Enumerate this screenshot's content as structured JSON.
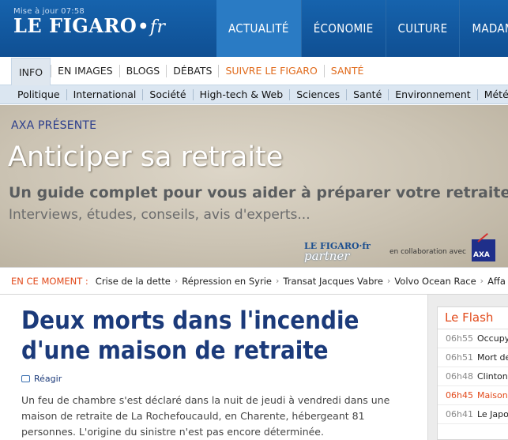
{
  "header": {
    "update_text": "Mise à jour 07:58",
    "logo_main": "LE FIGARO",
    "logo_dot": "•",
    "logo_fr": "fr",
    "tabs": [
      {
        "label": "ACTUALITÉ",
        "active": true
      },
      {
        "label": "ÉCONOMIE",
        "active": false
      },
      {
        "label": "CULTURE",
        "active": false
      },
      {
        "label": "MADAME",
        "active": false
      }
    ]
  },
  "subnav": {
    "items": [
      {
        "label": "INFO",
        "active": true
      },
      {
        "label": "EN IMAGES"
      },
      {
        "label": "BLOGS"
      },
      {
        "label": "DÉBATS"
      },
      {
        "label": "SUIVRE LE FIGARO",
        "orange": true
      },
      {
        "label": "SANTÉ",
        "orange": true
      }
    ]
  },
  "rubnav": {
    "items": [
      "Politique",
      "International",
      "Société",
      "High-tech & Web",
      "Sciences",
      "Santé",
      "Environnement",
      "Météo"
    ]
  },
  "ad": {
    "pre": "AXA PRÉSENTE",
    "headline": "Anticiper sa retraite",
    "sub": "Un guide complet  pour vous aider  à préparer votre retraite",
    "sub2": "Interviews, études,  conseils, avis d'experts...",
    "partner_top": "LE FIGARO·fr",
    "partner_bottom": "partner",
    "collab": "en collaboration avec",
    "axa": "AXA"
  },
  "moment": {
    "label": "EN CE MOMENT :",
    "topics": [
      "Crise de la dette",
      "Répression en Syrie",
      "Transat Jacques Vabre",
      "Volvo Ocean Race",
      "Affa"
    ]
  },
  "article": {
    "title": "Deux morts dans l'incendie d'une maison de retraite",
    "react": "Réagir",
    "chapo": "Un feu de chambre s'est déclaré dans la nuit de jeudi à vendredi dans une maison de retraite de La Rochefoucauld, en Charente, hébergeant 81 personnes. L'origine du sinistre n'est pas encore déterminée."
  },
  "flash": {
    "title": "Le Flash",
    "items": [
      {
        "time": "06h55",
        "text": "Occupy"
      },
      {
        "time": "06h51",
        "text": "Mort de"
      },
      {
        "time": "06h48",
        "text": "Clinton"
      },
      {
        "time": "06h45",
        "text": "Maison",
        "highlight": true
      },
      {
        "time": "06h41",
        "text": "Le Japo"
      }
    ]
  },
  "colors": {
    "header_blue": "#1663ad",
    "active_tab": "#2a7bc4",
    "accent_orange": "#e24a1b",
    "title_blue": "#1b3a7a"
  }
}
